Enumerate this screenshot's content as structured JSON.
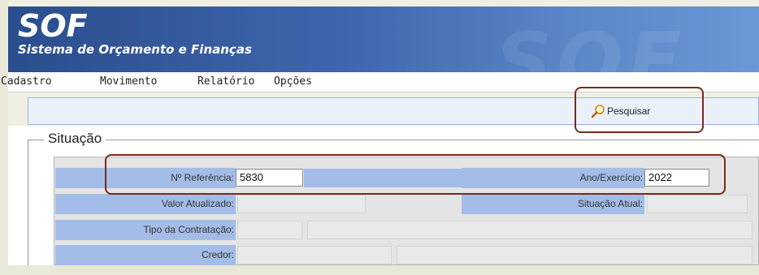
{
  "app": {
    "logo": "SOF",
    "subtitle": "Sistema de Orçamento e Finanças"
  },
  "menu": {
    "items": [
      "Cadastro",
      "Movimento",
      "Relatório",
      "Opções"
    ]
  },
  "toolbar": {
    "search_label": "Pesquisar",
    "search_icon": "magnifier-icon"
  },
  "section": {
    "legend": "Situação"
  },
  "form": {
    "ref_label": "Nº Referência:",
    "ref_value": "5830",
    "ano_label": "Ano/Exercício:",
    "ano_value": "2022",
    "valor_label": "Valor Atualizado:",
    "situacao_label": "Situação Atual:",
    "tipo_label": "Tipo da Contratação:",
    "credor_label": "Credor:"
  },
  "colors": {
    "header": "#3f66ad",
    "label_bg": "#a4bde8",
    "highlight_border": "#7a2a1a"
  }
}
